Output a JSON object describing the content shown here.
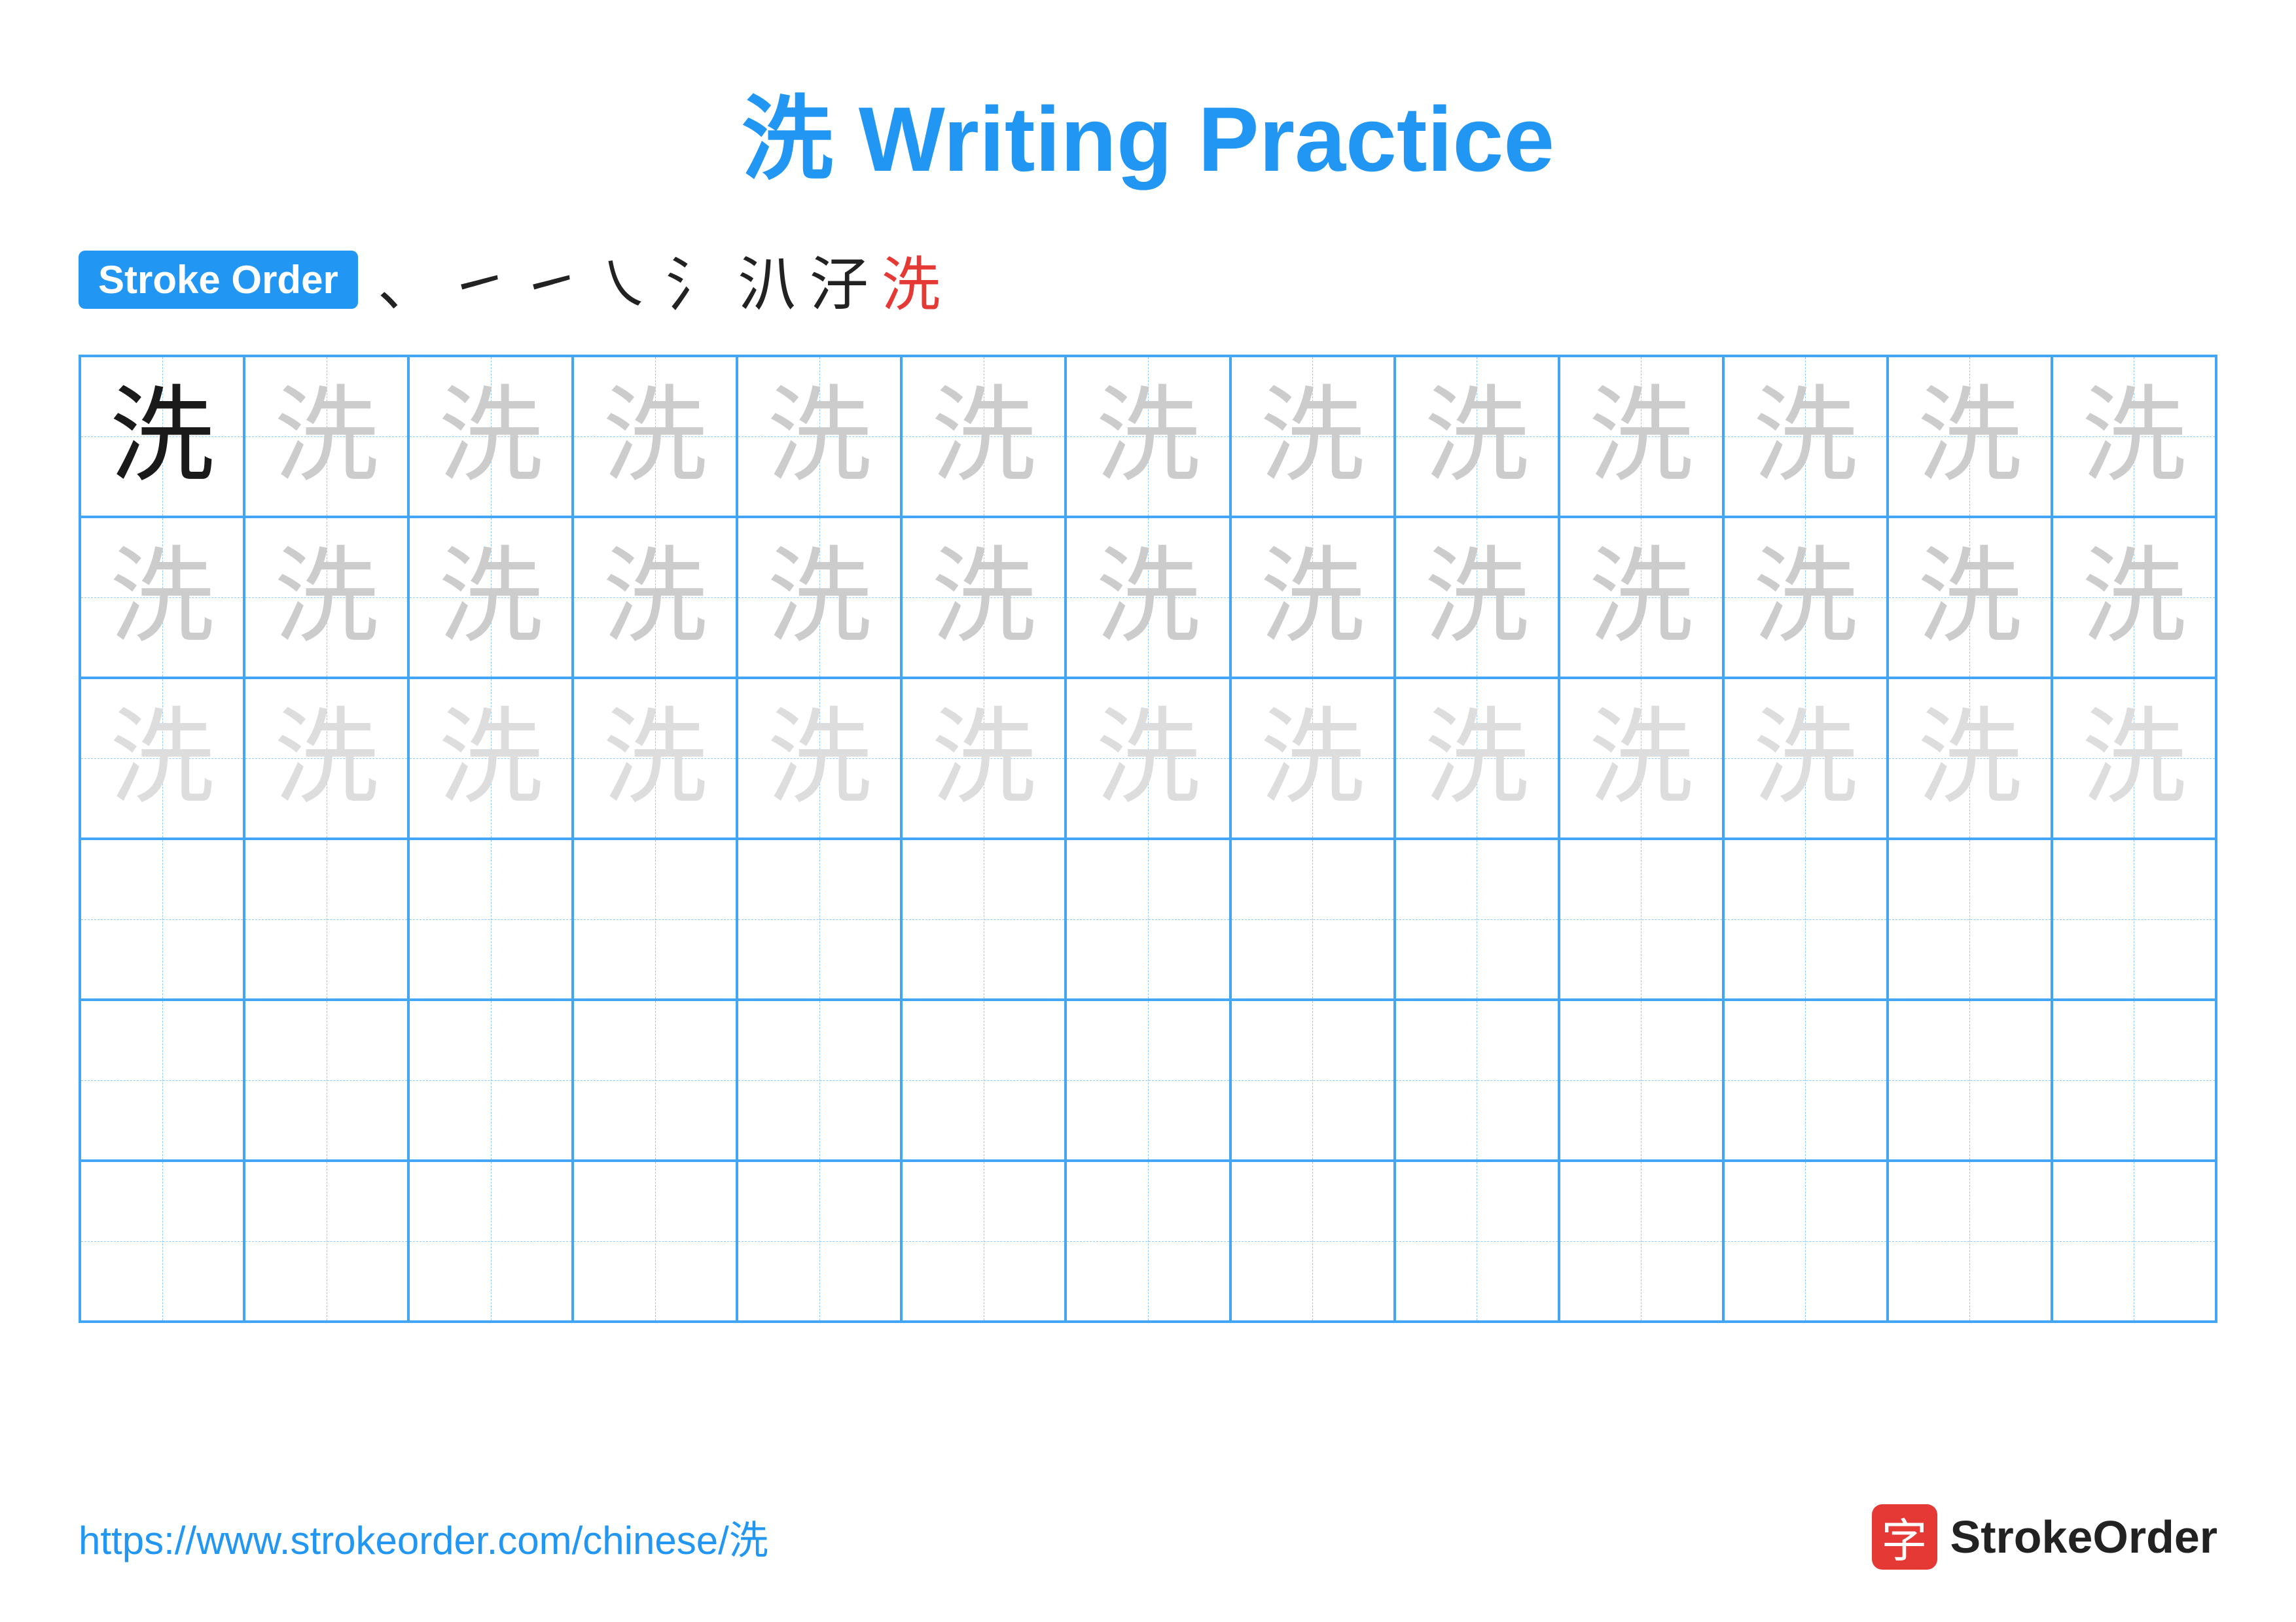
{
  "title": "洗 Writing Practice",
  "stroke_order_label": "Stroke Order",
  "stroke_sequence": [
    "、",
    "㇀",
    "㇀",
    "㇏",
    "氵",
    "汃",
    "汓",
    "洗"
  ],
  "character": "洗",
  "grid": {
    "cols": 13,
    "rows": 6,
    "row_types": [
      "solid_then_trace",
      "trace",
      "trace",
      "empty",
      "empty",
      "empty"
    ]
  },
  "footer": {
    "url": "https://www.strokeorder.com/chinese/洗",
    "logo_text": "StrokeOrder",
    "logo_icon": "字"
  }
}
